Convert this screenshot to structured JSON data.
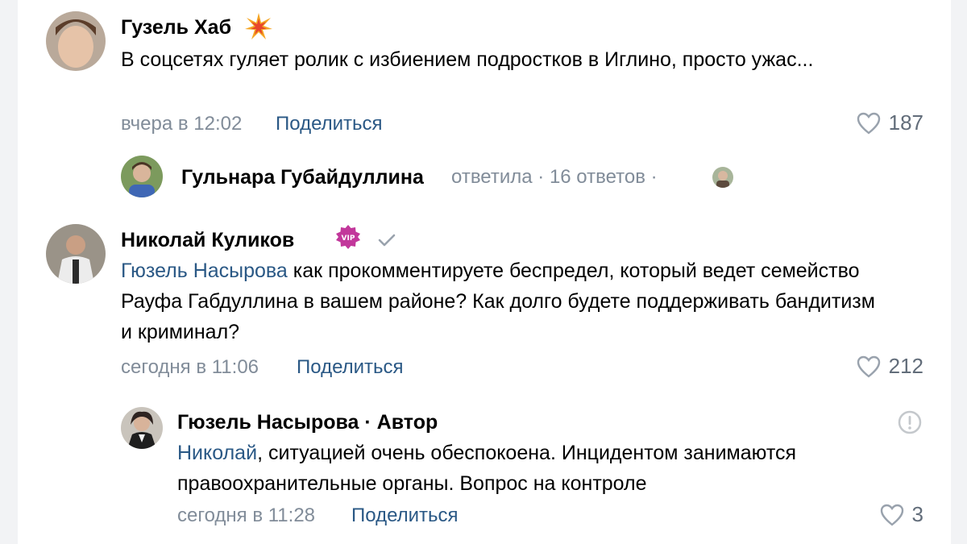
{
  "comments": [
    {
      "author": "Гузель Хаб",
      "badge_icon": "sparkle-emoji-icon",
      "text": "В соцсетях гуляет ролик с избиением подростков в Иглино, просто ужас...",
      "time": "вчера в 12:02",
      "share_label": "Поделиться",
      "likes": "187"
    },
    {
      "author": "Николай Куликов",
      "badge_icon": "vip-badge-icon",
      "verified_icon": "check-icon",
      "mention": "Гюзель Насырова",
      "text": " как прокомментируете беспредел, который ведет семейство Рауфа Габдуллина в вашем районе? Как долго будете поддерживать бандитизм и криминал?",
      "time": "сегодня в 11:06",
      "share_label": "Поделиться",
      "likes": "212"
    }
  ],
  "thread_summary": {
    "author": "Гульнара Губайдуллина",
    "action": "ответила",
    "dot": "·",
    "count": "16 ответов"
  },
  "reply": {
    "author_line": "Гюзель Насырова · Автор",
    "mention": "Николай",
    "text": ", ситуацией очень обеспокоена. Инцидентом занимаются правоохранительные органы. Вопрос на контроле",
    "time": "сегодня в 11:28",
    "share_label": "Поделиться",
    "likes": "3",
    "report_icon": "report-icon"
  },
  "colors": {
    "link": "#2a5885",
    "meta": "#818c99",
    "vip_badge": "#c2379b"
  }
}
